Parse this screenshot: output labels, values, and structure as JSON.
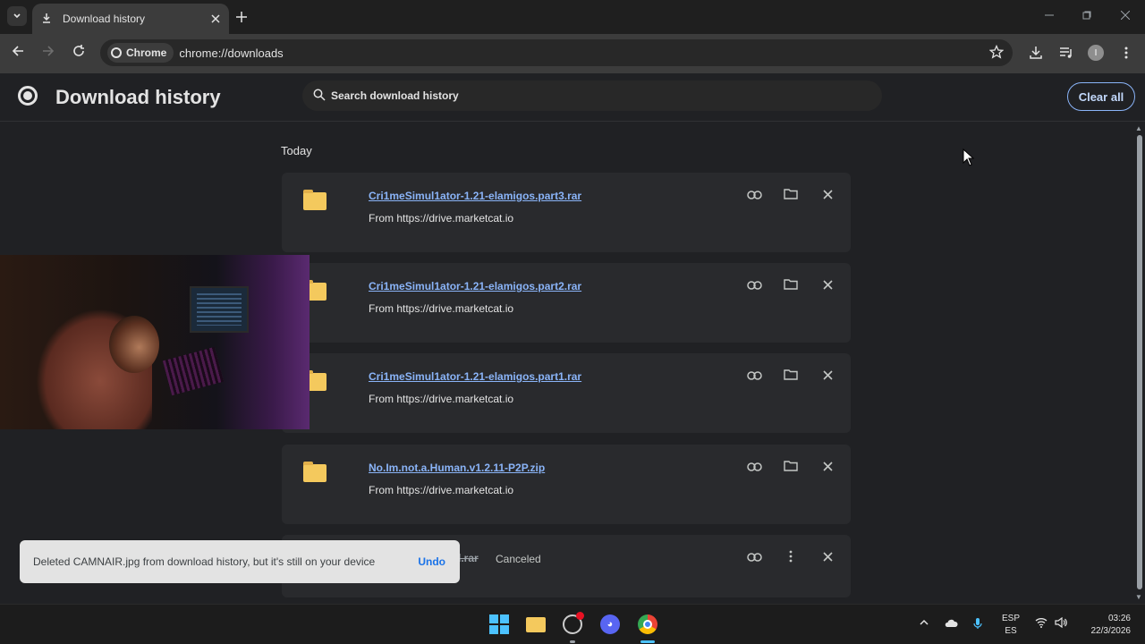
{
  "browser": {
    "tab": {
      "title": "Download history"
    },
    "omnibox": {
      "chip_label": "Chrome",
      "url": "chrome://downloads"
    },
    "avatar_letter": "I"
  },
  "page": {
    "title": "Download history",
    "search_placeholder": "Search download history",
    "clear_all_label": "Clear all",
    "section_label": "Today"
  },
  "downloads": [
    {
      "filename": "Cri1meSimul1ator-1.21-elamigos.part3.rar",
      "source": "From https://drive.marketcat.io"
    },
    {
      "filename": "Cri1meSimul1ator-1.21-elamigos.part2.rar",
      "source": "From https://drive.marketcat.io"
    },
    {
      "filename": "Cri1meSimul1ator-1.21-elamigos.part1.rar",
      "source": "From https://drive.marketcat.io"
    },
    {
      "filename": "No.Im.not.a.Human.v1.2.11-P2P.zip",
      "source": "From https://drive.marketcat.io"
    },
    {
      "filename": "d.rar",
      "status": "Canceled"
    }
  ],
  "toast": {
    "message": "Deleted CAMNAIR.jpg from download history, but it's still on your device",
    "undo_label": "Undo"
  },
  "taskbar": {
    "lang_top": "ESP",
    "lang_bottom": "ES",
    "time": "03:26",
    "date": "22/3/2026"
  },
  "colors": {
    "accent_link": "#8ab4f8",
    "background": "#202124",
    "card": "#292a2d",
    "toast": "#e3e3e3",
    "undo": "#1a73e8"
  },
  "icons": [
    "download-icon",
    "close-icon",
    "plus-icon",
    "back-icon",
    "forward-icon",
    "reload-icon",
    "star-icon",
    "downloads-icon",
    "media-icon",
    "menu-icon",
    "search-icon",
    "link-icon",
    "folder-icon",
    "more-icon"
  ]
}
